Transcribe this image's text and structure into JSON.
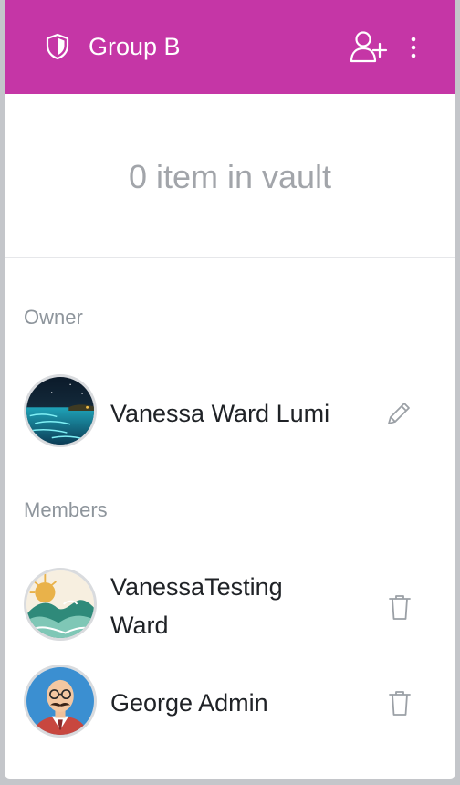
{
  "header": {
    "title": "Group B",
    "background_color": "#c536a6",
    "icons": [
      "shield-icon",
      "add-user-icon",
      "more-vertical-icon"
    ]
  },
  "vault": {
    "summary": "0 item in vault"
  },
  "owner_section": {
    "label": "Owner",
    "owner": {
      "name": "Vanessa Ward Lumi",
      "action_icon": "pencil-icon"
    }
  },
  "members_section": {
    "label": "Members",
    "members": [
      {
        "name_line1": "VanessaTesting",
        "name_line2": "Ward",
        "action_icon": "trash-icon"
      },
      {
        "name": "George Admin",
        "action_icon": "trash-icon"
      }
    ]
  }
}
